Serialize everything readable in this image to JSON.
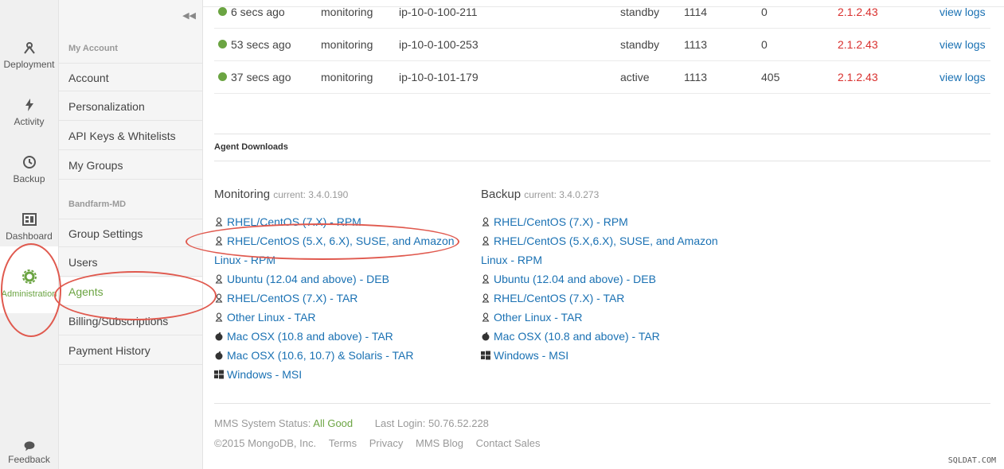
{
  "rail": [
    {
      "label": "Deployment",
      "icon": "deployment-icon"
    },
    {
      "label": "Activity",
      "icon": "bolt-icon"
    },
    {
      "label": "Backup",
      "icon": "history-icon"
    },
    {
      "label": "Dashboard",
      "icon": "dashboard-icon"
    },
    {
      "label": "Administration",
      "icon": "gear-icon",
      "active": true
    },
    {
      "label": "Feedback",
      "icon": "chat-bubble-icon"
    }
  ],
  "subnav": {
    "section1": "My Account",
    "items1": [
      "Account",
      "Personalization",
      "API Keys & Whitelists",
      "My Groups"
    ],
    "section2": "Bandfarm-MD",
    "items2": [
      "Group Settings",
      "Users",
      "Agents",
      "Billing/Subscriptions",
      "Payment History"
    ]
  },
  "agents_table": [
    {
      "last_ping": "6 secs ago",
      "type": "monitoring",
      "host": "ip-10-0-100-211",
      "state": "standby",
      "pid": "1114",
      "ops": "0",
      "version": "2.1.2.43",
      "logs": "view logs"
    },
    {
      "last_ping": "53 secs ago",
      "type": "monitoring",
      "host": "ip-10-0-100-253",
      "state": "standby",
      "pid": "1113",
      "ops": "0",
      "version": "2.1.2.43",
      "logs": "view logs"
    },
    {
      "last_ping": "37 secs ago",
      "type": "monitoring",
      "host": "ip-10-0-101-179",
      "state": "active",
      "pid": "1113",
      "ops": "405",
      "version": "2.1.2.43",
      "logs": "view logs"
    }
  ],
  "downloads": {
    "heading": "Agent Downloads",
    "monitoring": {
      "title": "Monitoring",
      "current": "current: 3.4.0.190",
      "links": [
        {
          "label": "RHEL/CentOS (7.X) - RPM",
          "os": "linux"
        },
        {
          "label": "RHEL/CentOS (5.X, 6.X), SUSE, and Amazon",
          "os": "linux"
        },
        {
          "label": "Linux - RPM",
          "os": "none"
        },
        {
          "label": "Ubuntu (12.04 and above) - DEB",
          "os": "linux"
        },
        {
          "label": "RHEL/CentOS (7.X) - TAR",
          "os": "linux"
        },
        {
          "label": "Other Linux - TAR",
          "os": "linux"
        },
        {
          "label": "Mac OSX (10.8 and above) - TAR",
          "os": "apple"
        },
        {
          "label": "Mac OSX (10.6, 10.7) & Solaris - TAR",
          "os": "apple"
        },
        {
          "label": "Windows - MSI",
          "os": "windows"
        }
      ]
    },
    "backup": {
      "title": "Backup",
      "current": "current: 3.4.0.273",
      "links": [
        {
          "label": "RHEL/CentOS (7.X) - RPM",
          "os": "linux"
        },
        {
          "label": "RHEL/CentOS (5.X,6.X), SUSE, and Amazon",
          "os": "linux"
        },
        {
          "label": "Linux - RPM",
          "os": "none"
        },
        {
          "label": "Ubuntu (12.04 and above) - DEB",
          "os": "linux"
        },
        {
          "label": "RHEL/CentOS (7.X) - TAR",
          "os": "linux"
        },
        {
          "label": "Other Linux - TAR",
          "os": "linux"
        },
        {
          "label": "Mac OSX (10.8 and above) - TAR",
          "os": "apple"
        },
        {
          "label": "Windows - MSI",
          "os": "windows"
        }
      ]
    }
  },
  "footer": {
    "status_label": "MMS System Status:",
    "status_value": "All Good",
    "last_login": "Last Login: 50.76.52.228",
    "copyright": "©2015 MongoDB, Inc.",
    "links": [
      "Terms",
      "Privacy",
      "MMS Blog",
      "Contact Sales"
    ]
  },
  "watermark": "SQLDAT.COM",
  "colors": {
    "accent_green": "#6ba442",
    "link_blue": "#1a71b3",
    "version_red": "#d9302e",
    "annotation_red": "#e0594e"
  }
}
